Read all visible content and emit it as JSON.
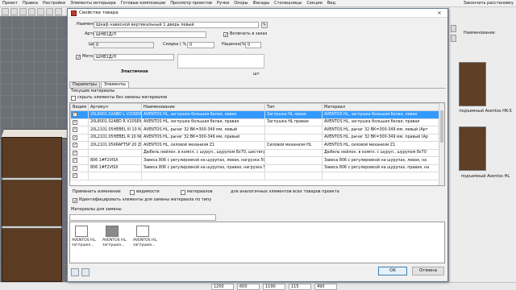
{
  "menubar": {
    "items": [
      "Проект",
      "Правка",
      "Настройки",
      "Элементы интерьера",
      "Готовые композиции",
      "Просмотр проектов",
      "Ручки",
      "Опоры",
      "Фасады",
      "Столешницы",
      "Секции",
      "Вид"
    ],
    "right": "Закончить расстановку"
  },
  "right_panel": {
    "header": "Наименование",
    "item1": "подъемный Aventos HK-S",
    "item2": "подъемный Aventos HL"
  },
  "status_bar": {
    "field1": "1200",
    "field2": "600",
    "field3": "1190",
    "field4": "115",
    "field5": "490"
  },
  "dialog": {
    "title": "Свойства товара",
    "close_glyph": "✕",
    "name_label": "Наименование",
    "name_value": "Шкаф навесной вертикальный 1 дверь левый",
    "article_label": "Артикул",
    "article_value": "ШНВ1Д/Л",
    "include_label": "Включать в заказ",
    "price_label": "Цена",
    "price_value": "0",
    "discount_label": "Скидка ( % )",
    "discount_value": "0",
    "markup_label": "Наценка(%)",
    "markup_value": "0",
    "mark_label": "Метка",
    "mark_value": "ШНВ1Д/Л",
    "unit_label": "шт",
    "elastic_label": "Эластичное",
    "tabs": [
      "Параметры",
      "Элементы"
    ],
    "current_materials_label": "Текущие материалы",
    "hide_no_replace_label": "скрыть элементы без замены материалов",
    "table": {
      "headers": [
        "Видим",
        "Артикул",
        "Наименование",
        "Тип",
        "Материал"
      ],
      "rows": [
        {
          "visible": true,
          "article": "20L8001.02ABD L V20SEW",
          "name": "AVENTOS HL, заглушка большая белая, левая",
          "type": "Заглушка HL левая",
          "material": "AVENTOS HL, заглушка большая белая, левая",
          "selected": true
        },
        {
          "visible": true,
          "article": "20L8001.02ABD R V20SEW",
          "name": "AVENTOS HL, заглушка большая белая, правая",
          "type": "Заглушка HL правая",
          "material": "AVENTOS HL, заглушка большая белая, правая",
          "selected": false
        },
        {
          "visible": true,
          "article": "20L2101.05HEBEL III 10 NI",
          "name": "AVENTOS HL, рычаг 32 ВК=300-349 мм, левый",
          "type": "",
          "material": "AVENTOS HL, рычаг 32 ВК=300-349 мм, левый (Арт",
          "selected": false
        },
        {
          "visible": true,
          "article": "20L2101.05HEBEL R 10 NI",
          "name": "AVENTOS HL, рычаг 32 ВК=300-349 мм, правый",
          "type": "",
          "material": "AVENTOS HL, рычаг 32 ВК=300-349 мм, правый (Ар",
          "selected": false
        },
        {
          "visible": true,
          "article": "20L2101.05KRAFTSP 20 ZN",
          "name": "AVENTOS HL, силовой механизм Z1",
          "type": "Силовой механизм HL",
          "material": "AVENTOS HL, силовой механизм Z1",
          "selected": false
        },
        {
          "visible": true,
          "article": "",
          "name": "Дюбель нейлон. в компл. с шуруп., шурупом 8x70, шестигранная головка, (Ди",
          "type": "",
          "material": "Дюбель нейлон. в компл. с шуруп., шурупом 8x70",
          "selected": false
        },
        {
          "visible": true,
          "article": "806 1#F2VISX",
          "name": "Завеса 806 с регулировкой на шурупах, левая, нагрузка 50 кг.",
          "type": "",
          "material": "Завеса 806 с регулировкой на шурупах, левая, на",
          "selected": false
        },
        {
          "visible": true,
          "article": "806 1#F2VISX",
          "name": "Завеса 806 с регулировкой на шурупах, правая, нагрузка 50 кг.",
          "type": "",
          "material": "Завеса 806 с регулировкой на шурупах, правая, на",
          "selected": false
        },
        {
          "visible": true,
          "article": "",
          "name": "",
          "type": "",
          "material": "",
          "selected": false
        }
      ]
    },
    "apply_change_label": "Применить изменение",
    "visibility_label": "видимости",
    "materials_label": "материалов",
    "for_similar_label": "для аналогичных элементов всех товаров проекта",
    "identify_label": "Идентифицировать элементы для замены материала по типу",
    "replace_materials_label": "Материалы для замены",
    "swatches": [
      {
        "label": "AVENTOS HL, заглушка...",
        "color": "#ffffff"
      },
      {
        "label": "AVENTOS HL, заглушка...",
        "color": "#8a8a8a"
      },
      {
        "label": "AVENTOS HL, заглушка...",
        "color": "#ffffff"
      }
    ],
    "ok_label": "OK",
    "cancel_label": "Отмена"
  }
}
